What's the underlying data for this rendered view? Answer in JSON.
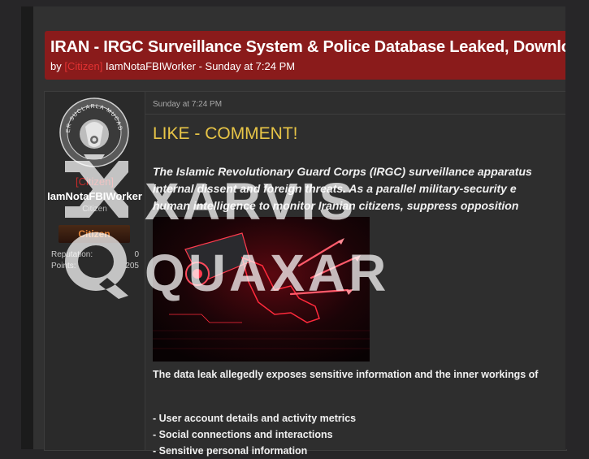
{
  "thread": {
    "title": "IRAN - IRGC Surveillance System & Police Database Leaked, Download",
    "by_label": "by",
    "author_rank": "[Citizen]",
    "author_name": "IamNotaFBIWorker",
    "meta_time": " - Sunday at 7:24 PM"
  },
  "user": {
    "rank_tag": "[Citizen]",
    "name": "IamNotaFBIWorker",
    "title": "Citizen",
    "rank_banner": "Citizen",
    "reputation_label": "Reputation:",
    "reputation_value": "0",
    "points_label": "Points:",
    "points_value": "205",
    "avatar_seal_text": "SIBER SUCLARLA MUCADELE"
  },
  "post": {
    "date": "Sunday at 7:24 PM",
    "headline": "LIKE - COMMENT!",
    "intro_lines": [
      "The Islamic Revolutionary Guard Corps (IRGC) surveillance apparatus",
      "internal dissent and foreign threats. As a parallel military-security e",
      "human intelligence to monitor Iranian citizens, suppress opposition"
    ],
    "paragraph": "The data leak allegedly exposes sensitive information and the inner workings of",
    "bullets": [
      "- User account details and activity metrics",
      "- Social connections and interactions",
      "- Sensitive personal information"
    ]
  },
  "watermark": {
    "line1": "XARVIS",
    "line2": "QUAXAR"
  },
  "colors": {
    "header_red": "#8a1b1b",
    "rank_red": "#c92a2a",
    "headline_yellow": "#e8c547",
    "background": "#272628"
  }
}
